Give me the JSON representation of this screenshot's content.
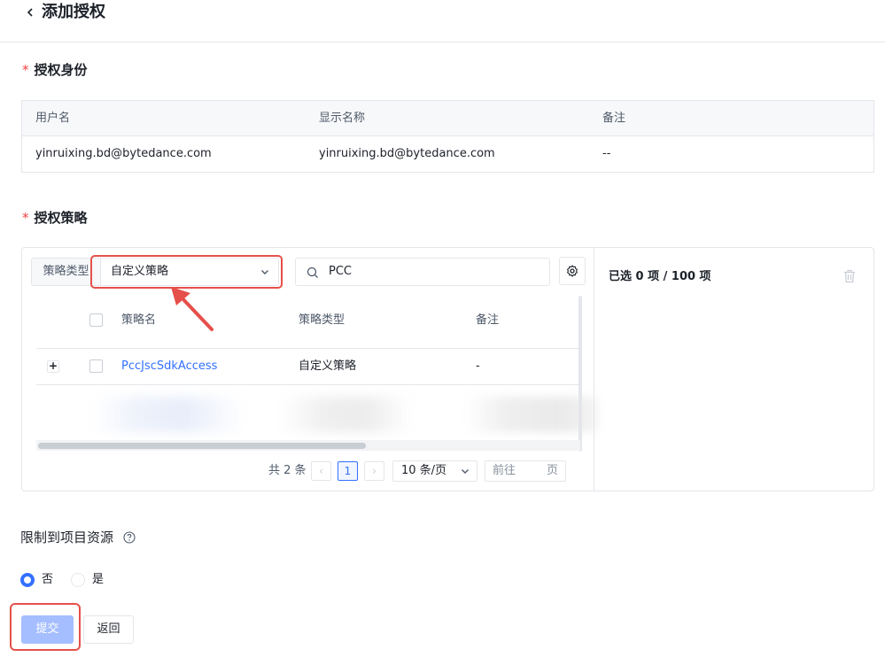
{
  "header": {
    "title": "添加授权",
    "back_icon": "chevron-left-icon"
  },
  "identity_section": {
    "title": "授权身份",
    "required_mark": "*",
    "columns": [
      "用户名",
      "显示名称",
      "备注"
    ],
    "rows": [
      {
        "username": "yinruixing.bd@bytedance.com",
        "display_name": "yinruixing.bd@bytedance.com",
        "note": "--"
      }
    ]
  },
  "policy_section": {
    "title": "授权策略",
    "required_mark": "*",
    "filter": {
      "type_label": "策略类型",
      "type_value": "自定义策略",
      "search_value": "PCC",
      "search_icon": "search-icon",
      "settings_icon": "gear-icon"
    },
    "table": {
      "columns": [
        "策略名",
        "策略类型",
        "备注"
      ],
      "rows": [
        {
          "expand_label": "+",
          "name": "PccJscSdkAccess",
          "type": "自定义策略",
          "note": "-"
        }
      ]
    },
    "pagination": {
      "total_label": "共 2 条",
      "prev": "‹",
      "current_page": "1",
      "next": "›",
      "page_size": "10 条/页",
      "goto_prefix": "前往",
      "goto_suffix": "页"
    },
    "selected": {
      "count_label": "已选 0 项 / 100 项",
      "clear_icon": "trash-icon"
    }
  },
  "restrict": {
    "title": "限制到项目资源",
    "help_icon": "question-circle-icon",
    "options": [
      {
        "label": "否",
        "checked": true
      },
      {
        "label": "是",
        "checked": false
      }
    ]
  },
  "actions": {
    "submit": "提交",
    "back": "返回"
  },
  "colors": {
    "primary": "#3370ff",
    "primary_disabled": "#a5beff",
    "annotation": "#e5504a",
    "required": "#f53f3f",
    "border": "#e5e6eb"
  }
}
